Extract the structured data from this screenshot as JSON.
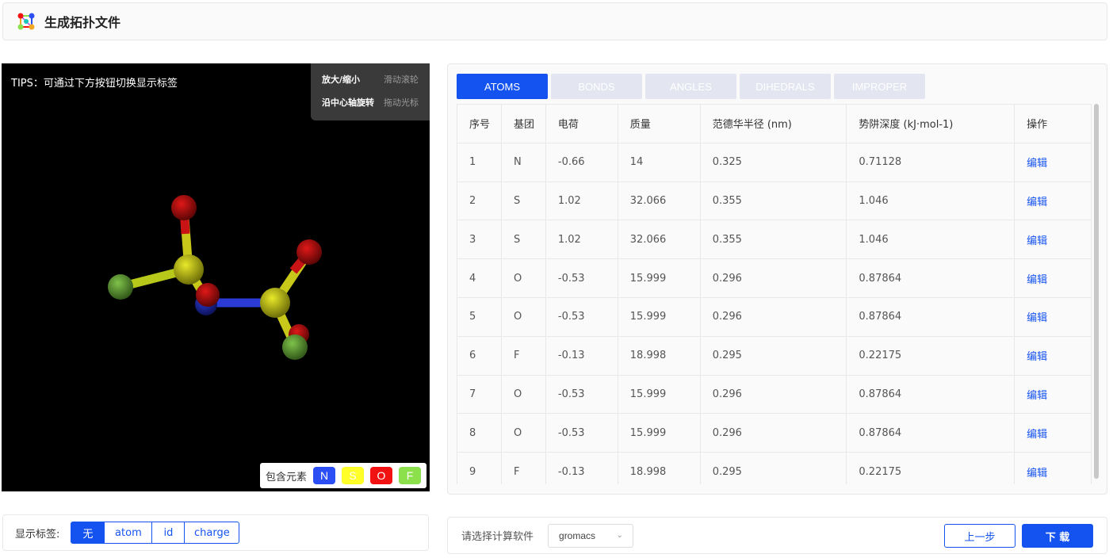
{
  "header": {
    "title": "生成拓扑文件",
    "logo_icon": "molecule-logo-icon"
  },
  "viewer": {
    "tips": "TIPS：可通过下方按钮切换显示标签",
    "help": [
      {
        "action": "放大/缩小",
        "control": "滑动滚轮"
      },
      {
        "action": "沿中心轴旋转",
        "control": "拖动光标"
      }
    ],
    "legend_label": "包含元素",
    "elements": [
      {
        "symbol": "N",
        "color": "#2b4ff5"
      },
      {
        "symbol": "S",
        "color": "#ffff2a"
      },
      {
        "symbol": "O",
        "color": "#f21212"
      },
      {
        "symbol": "F",
        "color": "#8be04b"
      }
    ]
  },
  "label_bar": {
    "label": "显示标签:",
    "options": [
      "无",
      "atom",
      "id",
      "charge"
    ],
    "selected": "无"
  },
  "tabs": [
    "ATOMS",
    "BONDS",
    "ANGLES",
    "DIHEDRALS",
    "IMPROPER"
  ],
  "active_tab": "ATOMS",
  "table": {
    "columns": [
      "序号",
      "基团",
      "电荷",
      "质量",
      "范德华半径 (nm)",
      "势阱深度 (kJ·mol-1)",
      "操作"
    ],
    "rows": [
      [
        "1",
        "N",
        "-0.66",
        "14",
        "0.325",
        "0.71128",
        "编辑"
      ],
      [
        "2",
        "S",
        "1.02",
        "32.066",
        "0.355",
        "1.046",
        "编辑"
      ],
      [
        "3",
        "S",
        "1.02",
        "32.066",
        "0.355",
        "1.046",
        "编辑"
      ],
      [
        "4",
        "O",
        "-0.53",
        "15.999",
        "0.296",
        "0.87864",
        "编辑"
      ],
      [
        "5",
        "O",
        "-0.53",
        "15.999",
        "0.296",
        "0.87864",
        "编辑"
      ],
      [
        "6",
        "F",
        "-0.13",
        "18.998",
        "0.295",
        "0.22175",
        "编辑"
      ],
      [
        "7",
        "O",
        "-0.53",
        "15.999",
        "0.296",
        "0.87864",
        "编辑"
      ],
      [
        "8",
        "O",
        "-0.53",
        "15.999",
        "0.296",
        "0.87864",
        "编辑"
      ],
      [
        "9",
        "F",
        "-0.13",
        "18.998",
        "0.295",
        "0.22175",
        "编辑"
      ]
    ]
  },
  "bottom": {
    "software_label": "请选择计算软件",
    "software_value": "gromacs",
    "prev_label": "上一步",
    "download_label": "下 载"
  },
  "colors": {
    "primary": "#1553f0",
    "tab_inactive": "#e3e5f1"
  }
}
